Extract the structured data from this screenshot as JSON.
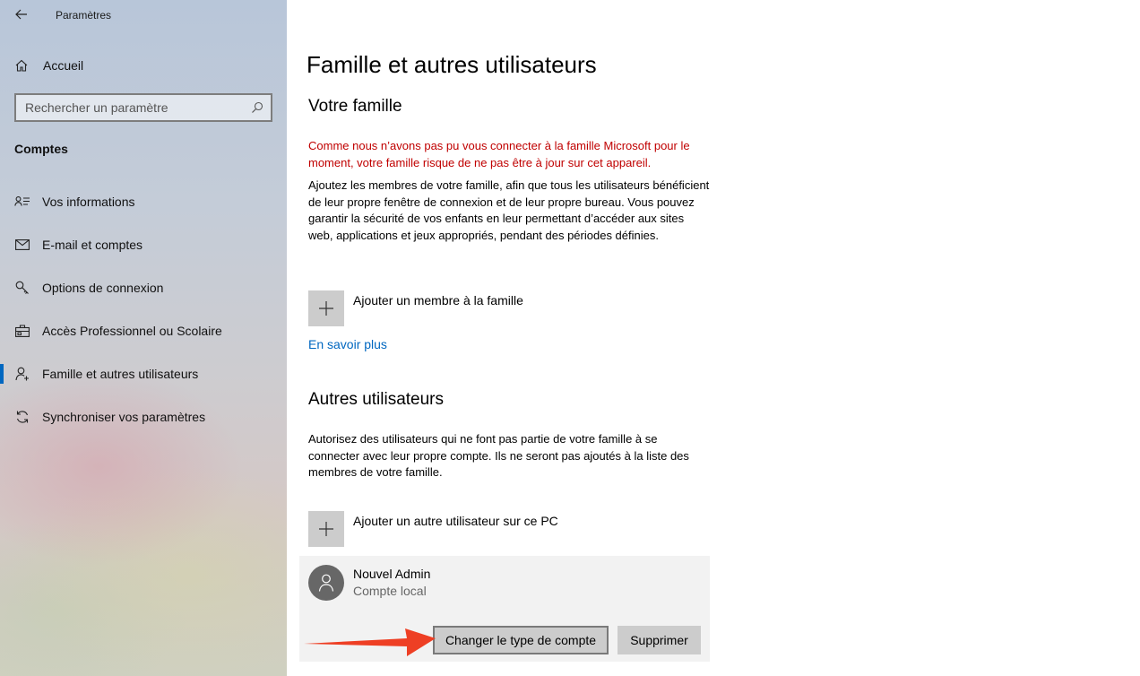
{
  "window": {
    "title": "Paramètres"
  },
  "sidebar": {
    "home_label": "Accueil",
    "search_placeholder": "Rechercher un paramètre",
    "section_label": "Comptes",
    "items": [
      {
        "label": "Vos informations",
        "icon": "person-card-icon"
      },
      {
        "label": "E-mail et comptes",
        "icon": "mail-icon"
      },
      {
        "label": "Options de connexion",
        "icon": "key-icon"
      },
      {
        "label": "Accès Professionnel ou Scolaire",
        "icon": "briefcase-icon"
      },
      {
        "label": "Famille et autres utilisateurs",
        "icon": "person-add-icon",
        "active": true
      },
      {
        "label": "Synchroniser vos paramètres",
        "icon": "sync-icon"
      }
    ]
  },
  "main": {
    "title": "Famille et autres utilisateurs",
    "family": {
      "heading": "Votre famille",
      "warning": "Comme nous n’avons pas pu vous connecter à la famille Microsoft pour le moment, votre famille risque de ne pas être à jour sur cet appareil.",
      "description": "Ajoutez les membres de votre famille, afin que tous les utilisateurs bénéficient de leur propre fenêtre de connexion et de leur propre bureau. Vous pouvez garantir la sécurité de vos enfants en leur permettant d’accéder aux sites web, applications et jeux appropriés, pendant des périodes définies.",
      "add_label": "Ajouter un membre à la famille",
      "learn_more": "En savoir plus"
    },
    "others": {
      "heading": "Autres utilisateurs",
      "description": "Autorisez des utilisateurs qui ne font pas partie de votre famille à se connecter avec leur propre compte. Ils ne seront pas ajoutés à la liste des membres de votre famille.",
      "add_label": "Ajouter un autre utilisateur sur ce PC",
      "user": {
        "name": "Nouvel Admin",
        "type": "Compte local",
        "change_button": "Changer le type de compte",
        "delete_button": "Supprimer"
      }
    }
  },
  "colors": {
    "accent": "#0067c0",
    "warning": "#c00000",
    "annotation_arrow": "#ee3f24"
  }
}
